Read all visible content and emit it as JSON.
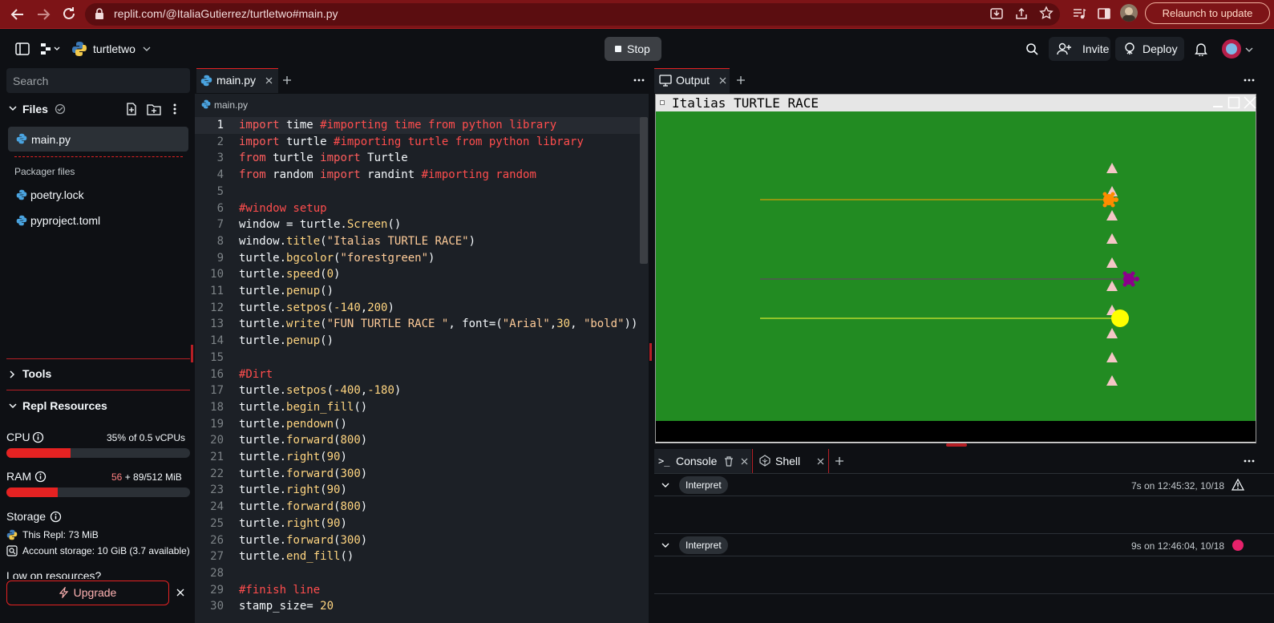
{
  "browser": {
    "url": "replit.com/@ItaliaGutierrez/turtletwo#main.py",
    "relaunch_label": "Relaunch to update"
  },
  "header": {
    "project_name": "turtletwo",
    "stop_label": "Stop",
    "invite_label": "Invite",
    "deploy_label": "Deploy"
  },
  "sidebar": {
    "search_placeholder": "Search",
    "files_label": "Files",
    "files": [
      "main.py"
    ],
    "packager_label": "Packager files",
    "packager_files": [
      "poetry.lock",
      "pyproject.toml"
    ],
    "tools_label": "Tools",
    "resources_label": "Repl Resources",
    "cpu_label": "CPU",
    "cpu_value": "35% of 0.5 vCPUs",
    "cpu_fraction": 0.35,
    "ram_label": "RAM",
    "ram_used": "56",
    "ram_value": " + 89/512 MiB",
    "ram_fraction": 0.28,
    "storage_label": "Storage",
    "this_repl": "This Repl: 73 MiB",
    "account_storage": "Account storage: 10 GiB (3.7 available)",
    "low_resources": "Low on resources?",
    "upgrade_label": "Upgrade"
  },
  "editor": {
    "tab_label": "main.py",
    "breadcrumb": "main.py",
    "lines": [
      [
        [
          "k",
          "import"
        ],
        [
          "p",
          " time "
        ],
        [
          "c",
          "#importing time from python library"
        ]
      ],
      [
        [
          "k",
          "import"
        ],
        [
          "p",
          " turtle "
        ],
        [
          "c",
          "#importing turtle from python library"
        ]
      ],
      [
        [
          "k",
          "from"
        ],
        [
          "p",
          " turtle "
        ],
        [
          "k",
          "import"
        ],
        [
          "p",
          " Turtle"
        ]
      ],
      [
        [
          "k",
          "from"
        ],
        [
          "p",
          " random "
        ],
        [
          "k",
          "import"
        ],
        [
          "p",
          " randint "
        ],
        [
          "c",
          "#importing random"
        ]
      ],
      [],
      [
        [
          "c",
          "#window setup"
        ]
      ],
      [
        [
          "p",
          "window = turtle."
        ],
        [
          "f",
          "Screen"
        ],
        [
          "p",
          "()"
        ]
      ],
      [
        [
          "p",
          "window."
        ],
        [
          "f",
          "title"
        ],
        [
          "p",
          "("
        ],
        [
          "s",
          "\"Italias TURTLE RACE\""
        ],
        [
          "p",
          ")"
        ]
      ],
      [
        [
          "p",
          "turtle."
        ],
        [
          "f",
          "bgcolor"
        ],
        [
          "p",
          "("
        ],
        [
          "s",
          "\"forestgreen\""
        ],
        [
          "p",
          ")"
        ]
      ],
      [
        [
          "p",
          "turtle."
        ],
        [
          "f",
          "speed"
        ],
        [
          "p",
          "("
        ],
        [
          "n",
          "0"
        ],
        [
          "p",
          ")"
        ]
      ],
      [
        [
          "p",
          "turtle."
        ],
        [
          "f",
          "penup"
        ],
        [
          "p",
          "()"
        ]
      ],
      [
        [
          "p",
          "turtle."
        ],
        [
          "f",
          "setpos"
        ],
        [
          "p",
          "("
        ],
        [
          "n",
          "-140"
        ],
        [
          "p",
          ","
        ],
        [
          "n",
          "200"
        ],
        [
          "p",
          ")"
        ]
      ],
      [
        [
          "p",
          "turtle."
        ],
        [
          "f",
          "write"
        ],
        [
          "p",
          "("
        ],
        [
          "s",
          "\"FUN TURTLE RACE \""
        ],
        [
          "p",
          ", font=("
        ],
        [
          "s",
          "\"Arial\""
        ],
        [
          "p",
          ","
        ],
        [
          "n",
          "30"
        ],
        [
          "p",
          ", "
        ],
        [
          "s",
          "\"bold\""
        ],
        [
          "p",
          "))"
        ]
      ],
      [
        [
          "p",
          "turtle."
        ],
        [
          "f",
          "penup"
        ],
        [
          "p",
          "()"
        ]
      ],
      [],
      [
        [
          "c",
          "#Dirt"
        ]
      ],
      [
        [
          "p",
          "turtle."
        ],
        [
          "f",
          "setpos"
        ],
        [
          "p",
          "("
        ],
        [
          "n",
          "-400"
        ],
        [
          "p",
          ","
        ],
        [
          "n",
          "-180"
        ],
        [
          "p",
          ")"
        ]
      ],
      [
        [
          "p",
          "turtle."
        ],
        [
          "f",
          "begin_fill"
        ],
        [
          "p",
          "()"
        ]
      ],
      [
        [
          "p",
          "turtle."
        ],
        [
          "f",
          "pendown"
        ],
        [
          "p",
          "()"
        ]
      ],
      [
        [
          "p",
          "turtle."
        ],
        [
          "f",
          "forward"
        ],
        [
          "p",
          "("
        ],
        [
          "n",
          "800"
        ],
        [
          "p",
          ")"
        ]
      ],
      [
        [
          "p",
          "turtle."
        ],
        [
          "f",
          "right"
        ],
        [
          "p",
          "("
        ],
        [
          "n",
          "90"
        ],
        [
          "p",
          ")"
        ]
      ],
      [
        [
          "p",
          "turtle."
        ],
        [
          "f",
          "forward"
        ],
        [
          "p",
          "("
        ],
        [
          "n",
          "300"
        ],
        [
          "p",
          ")"
        ]
      ],
      [
        [
          "p",
          "turtle."
        ],
        [
          "f",
          "right"
        ],
        [
          "p",
          "("
        ],
        [
          "n",
          "90"
        ],
        [
          "p",
          ")"
        ]
      ],
      [
        [
          "p",
          "turtle."
        ],
        [
          "f",
          "forward"
        ],
        [
          "p",
          "("
        ],
        [
          "n",
          "800"
        ],
        [
          "p",
          ")"
        ]
      ],
      [
        [
          "p",
          "turtle."
        ],
        [
          "f",
          "right"
        ],
        [
          "p",
          "("
        ],
        [
          "n",
          "90"
        ],
        [
          "p",
          ")"
        ]
      ],
      [
        [
          "p",
          "turtle."
        ],
        [
          "f",
          "forward"
        ],
        [
          "p",
          "("
        ],
        [
          "n",
          "300"
        ],
        [
          "p",
          ")"
        ]
      ],
      [
        [
          "p",
          "turtle."
        ],
        [
          "f",
          "end_fill"
        ],
        [
          "p",
          "()"
        ]
      ],
      [],
      [
        [
          "c",
          "#finish line"
        ]
      ],
      [
        [
          "p",
          "stamp_size= "
        ],
        [
          "n",
          "20"
        ]
      ]
    ]
  },
  "output": {
    "tab_label": "Output",
    "window_title": "Italias TURTLE RACE",
    "canvas_color": "#228b22"
  },
  "console": {
    "tab_label": "Console",
    "shell_label": "Shell",
    "runs": [
      {
        "label": "Interpret",
        "time": "7s on 12:45:32, 10/18"
      },
      {
        "label": "Interpret",
        "time": "9s on 12:46:04, 10/18"
      }
    ]
  }
}
